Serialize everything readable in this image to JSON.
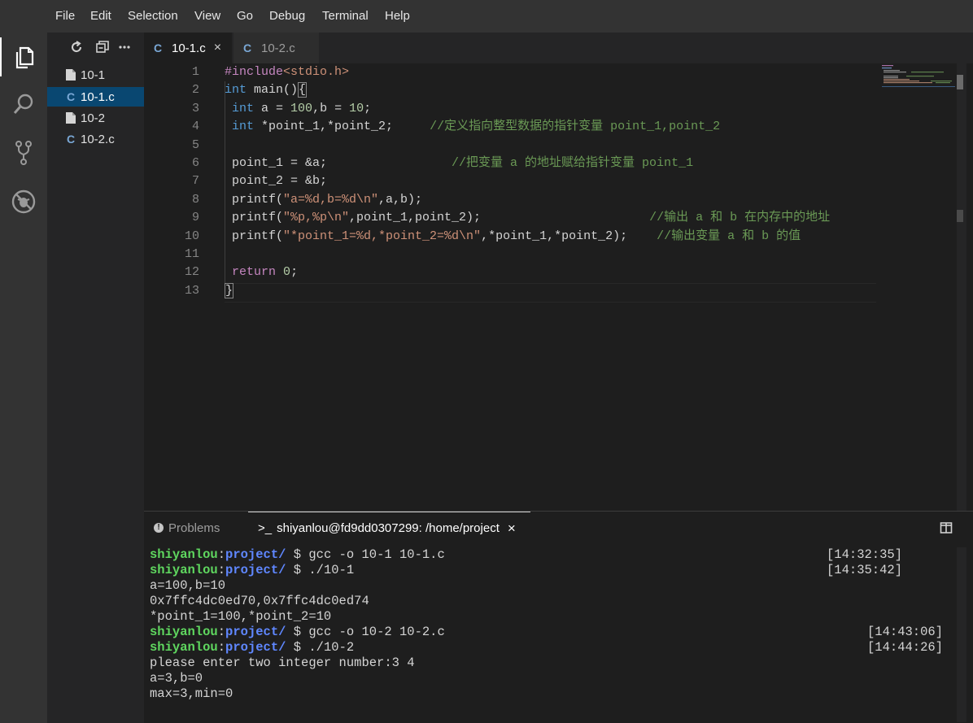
{
  "menubar": {
    "items": [
      "File",
      "Edit",
      "Selection",
      "View",
      "Go",
      "Debug",
      "Terminal",
      "Help"
    ]
  },
  "activitybar": {
    "icons": [
      "files-icon",
      "search-icon",
      "source-control-icon",
      "debug-icon"
    ]
  },
  "explorer": {
    "files": [
      {
        "name": "10-1",
        "type": "file"
      },
      {
        "name": "10-1.c",
        "type": "c",
        "selected": true
      },
      {
        "name": "10-2",
        "type": "file"
      },
      {
        "name": "10-2.c",
        "type": "c"
      }
    ]
  },
  "tabs": [
    {
      "label": "10-1.c",
      "active": true,
      "close": "×"
    },
    {
      "label": "10-2.c",
      "active": false
    }
  ],
  "editor": {
    "line_numbers": [
      "1",
      "2",
      "3",
      "4",
      "5",
      "6",
      "7",
      "8",
      "9",
      "10",
      "11",
      "12",
      "13"
    ],
    "lines": [
      [
        [
          "pp",
          "#include"
        ],
        [
          "str",
          "<stdio.h>"
        ]
      ],
      [
        [
          "kw",
          "int"
        ],
        [
          "txt",
          " main(){"
        ]
      ],
      [
        [
          "txt",
          " "
        ],
        [
          "kw",
          "int"
        ],
        [
          "txt",
          " a = "
        ],
        [
          "num",
          "100"
        ],
        [
          "txt",
          ",b = "
        ],
        [
          "num",
          "10"
        ],
        [
          "txt",
          ";"
        ]
      ],
      [
        [
          "txt",
          " "
        ],
        [
          "kw",
          "int"
        ],
        [
          "txt",
          " *point_1,*point_2;     "
        ],
        [
          "cmt",
          "//定义指向整型数据的指针变量 point_1,point_2"
        ]
      ],
      [
        [
          "txt",
          ""
        ]
      ],
      [
        [
          "txt",
          " point_1 = &a;                 "
        ],
        [
          "cmt",
          "//把变量 a 的地址赋给指针变量 point_1"
        ]
      ],
      [
        [
          "txt",
          " point_2 = &b;"
        ]
      ],
      [
        [
          "txt",
          " printf("
        ],
        [
          "str",
          "\"a=%d,b=%d\\n\""
        ],
        [
          "txt",
          ",a,b);"
        ]
      ],
      [
        [
          "txt",
          " printf("
        ],
        [
          "str",
          "\"%p,%p\\n\""
        ],
        [
          "txt",
          ",point_1,point_2);                       "
        ],
        [
          "cmt",
          "//输出 a 和 b 在内存中的地址"
        ]
      ],
      [
        [
          "txt",
          " printf("
        ],
        [
          "str",
          "\"*point_1=%d,*point_2=%d\\n\""
        ],
        [
          "txt",
          ",*point_1,*point_2);    "
        ],
        [
          "cmt",
          "//输出变量 a 和 b 的值"
        ]
      ],
      [
        [
          "txt",
          ""
        ]
      ],
      [
        [
          "txt",
          " "
        ],
        [
          "pp",
          "return"
        ],
        [
          "txt",
          " "
        ],
        [
          "num",
          "0"
        ],
        [
          "txt",
          ";"
        ]
      ],
      [
        [
          "txt",
          "}"
        ]
      ]
    ]
  },
  "panel": {
    "problems_label": "Problems",
    "terminal_label": "shiyanlou@fd9dd0307299: /home/project",
    "terminal_prefix": ">_",
    "close": "×",
    "terminal_lines": [
      {
        "kind": "prompt",
        "user": "shiyanlou",
        "path": "project/",
        "cmd": " $ gcc -o 10-1 10-1.c",
        "time": "[14:32:35]",
        "time_col": "a"
      },
      {
        "kind": "prompt",
        "user": "shiyanlou",
        "path": "project/",
        "cmd": " $ ./10-1",
        "time": "[14:35:42]",
        "time_col": "a"
      },
      {
        "kind": "out",
        "text": "a=100,b=10"
      },
      {
        "kind": "out",
        "text": "0x7ffc4dc0ed70,0x7ffc4dc0ed74"
      },
      {
        "kind": "out",
        "text": "*point_1=100,*point_2=10"
      },
      {
        "kind": "prompt",
        "user": "shiyanlou",
        "path": "project/",
        "cmd": " $ gcc -o 10-2 10-2.c",
        "time": "[14:43:06]",
        "time_col": "b"
      },
      {
        "kind": "prompt",
        "user": "shiyanlou",
        "path": "project/",
        "cmd": " $ ./10-2",
        "time": "[14:44:26]",
        "time_col": "b"
      },
      {
        "kind": "out",
        "text": "please enter two integer number:3 4"
      },
      {
        "kind": "out",
        "text": "a=3,b=0"
      },
      {
        "kind": "out",
        "text": "max=3,min=0"
      }
    ]
  },
  "colors": {
    "accent": "#094771",
    "keyword": "#569cd6",
    "comment": "#6a9955",
    "string": "#ce9178",
    "number": "#b5cea8",
    "terminal_user": "#5fd75f",
    "terminal_path": "#5f87ff"
  }
}
